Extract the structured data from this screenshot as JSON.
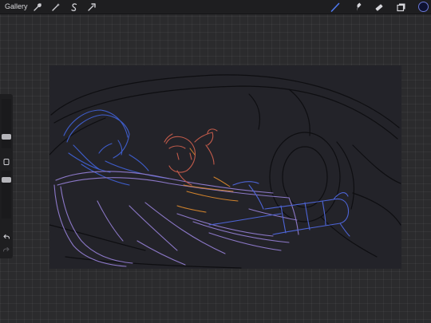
{
  "toolbar": {
    "gallery_label": "Gallery",
    "left_tools": [
      "wrench-icon",
      "magic-wand-icon",
      "selection-icon",
      "transform-icon"
    ],
    "right_tools": [
      "brush-icon",
      "smudge-icon",
      "eraser-icon",
      "layers-icon"
    ],
    "active_tool": "brush-icon",
    "active_tool_color": "#4f79f0",
    "current_color": "#0e1230"
  },
  "sidebar": {
    "brush_size_level": 0.2,
    "opacity_level": 0.85,
    "buttons": [
      "modify-button",
      "undo-button",
      "redo-button"
    ]
  },
  "canvas": {
    "background": "#232329",
    "sketch_colors": {
      "frame_lines": "#0f0f12",
      "figure_back": "#3e5cc8",
      "figure_front": "#8c78c8",
      "figure_small": "#c05a4a",
      "accent_orange": "#d0822c"
    }
  }
}
